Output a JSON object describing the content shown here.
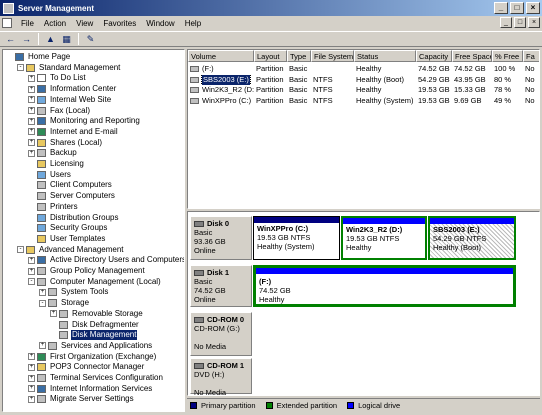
{
  "window": {
    "title": "Server Management",
    "controls": [
      "_",
      "□",
      "×"
    ]
  },
  "menu": {
    "items": [
      "File",
      "Action",
      "View",
      "Favorites",
      "Window",
      "Help"
    ],
    "controls": [
      "_",
      "□",
      "×"
    ]
  },
  "toolbar": {
    "buttons": [
      "back-icon",
      "forward-icon",
      "up-icon",
      "console-tree-icon",
      "properties-icon"
    ],
    "glyphs": [
      "←",
      "→",
      "▲",
      "▦",
      "✎"
    ]
  },
  "tree": [
    {
      "label": "Home Page",
      "level": 0,
      "exp": "",
      "icon": "home-icon",
      "color": "#3a6ea5"
    },
    {
      "label": "Standard Management",
      "level": 1,
      "exp": "-",
      "icon": "folder-icon",
      "color": "#e8c860"
    },
    {
      "label": "To Do List",
      "level": 2,
      "exp": "+",
      "icon": "list-icon",
      "color": "#ffffff"
    },
    {
      "label": "Information Center",
      "level": 2,
      "exp": "+",
      "icon": "info-icon",
      "color": "#3a6ea5"
    },
    {
      "label": "Internal Web Site",
      "level": 2,
      "exp": "+",
      "icon": "web-icon",
      "color": "#6fa8dc"
    },
    {
      "label": "Fax (Local)",
      "level": 2,
      "exp": "+",
      "icon": "fax-icon",
      "color": "#c0c0c0"
    },
    {
      "label": "Monitoring and Reporting",
      "level": 2,
      "exp": "+",
      "icon": "monitor-icon",
      "color": "#3a6ea5"
    },
    {
      "label": "Internet and E-mail",
      "level": 2,
      "exp": "+",
      "icon": "globe-icon",
      "color": "#2e8b57"
    },
    {
      "label": "Shares (Local)",
      "level": 2,
      "exp": "+",
      "icon": "share-icon",
      "color": "#e8c860"
    },
    {
      "label": "Backup",
      "level": 2,
      "exp": "+",
      "icon": "backup-icon",
      "color": "#c0c0c0"
    },
    {
      "label": "Licensing",
      "level": 2,
      "exp": "",
      "icon": "license-icon",
      "color": "#e8c860"
    },
    {
      "label": "Users",
      "level": 2,
      "exp": "",
      "icon": "users-icon",
      "color": "#6fa8dc"
    },
    {
      "label": "Client Computers",
      "level": 2,
      "exp": "",
      "icon": "computer-icon",
      "color": "#c0c0c0"
    },
    {
      "label": "Server Computers",
      "level": 2,
      "exp": "",
      "icon": "server-icon",
      "color": "#c0c0c0"
    },
    {
      "label": "Printers",
      "level": 2,
      "exp": "",
      "icon": "printer-icon",
      "color": "#c0c0c0"
    },
    {
      "label": "Distribution Groups",
      "level": 2,
      "exp": "",
      "icon": "group-icon",
      "color": "#6fa8dc"
    },
    {
      "label": "Security Groups",
      "level": 2,
      "exp": "",
      "icon": "group-icon",
      "color": "#6fa8dc"
    },
    {
      "label": "User Templates",
      "level": 2,
      "exp": "",
      "icon": "template-icon",
      "color": "#e8c860"
    },
    {
      "label": "Advanced Management",
      "level": 1,
      "exp": "-",
      "icon": "folder-icon",
      "color": "#e8c860"
    },
    {
      "label": "Active Directory Users and Computers",
      "level": 2,
      "exp": "+",
      "icon": "directory-icon",
      "color": "#3a6ea5"
    },
    {
      "label": "Group Policy Management",
      "level": 2,
      "exp": "+",
      "icon": "policy-icon",
      "color": "#c0c0c0"
    },
    {
      "label": "Computer Management (Local)",
      "level": 2,
      "exp": "-",
      "icon": "computer-icon",
      "color": "#c0c0c0"
    },
    {
      "label": "System Tools",
      "level": 3,
      "exp": "+",
      "icon": "tools-icon",
      "color": "#c0c0c0"
    },
    {
      "label": "Storage",
      "level": 3,
      "exp": "-",
      "icon": "storage-icon",
      "color": "#c0c0c0"
    },
    {
      "label": "Removable Storage",
      "level": 4,
      "exp": "+",
      "icon": "removable-icon",
      "color": "#c0c0c0"
    },
    {
      "label": "Disk Defragmenter",
      "level": 4,
      "exp": "",
      "icon": "defrag-icon",
      "color": "#c0c0c0"
    },
    {
      "label": "Disk Management",
      "level": 4,
      "exp": "",
      "icon": "disk-icon",
      "color": "#c0c0c0",
      "selected": true
    },
    {
      "label": "Services and Applications",
      "level": 3,
      "exp": "+",
      "icon": "services-icon",
      "color": "#c0c0c0"
    },
    {
      "label": "First Organization (Exchange)",
      "level": 2,
      "exp": "+",
      "icon": "exchange-icon",
      "color": "#2e8b57"
    },
    {
      "label": "POP3 Connector Manager",
      "level": 2,
      "exp": "+",
      "icon": "mail-icon",
      "color": "#e8c860"
    },
    {
      "label": "Terminal Services Configuration",
      "level": 2,
      "exp": "+",
      "icon": "terminal-icon",
      "color": "#c0c0c0"
    },
    {
      "label": "Internet Information Services",
      "level": 2,
      "exp": "+",
      "icon": "iis-icon",
      "color": "#3a6ea5"
    },
    {
      "label": "Migrate Server Settings",
      "level": 2,
      "exp": "+",
      "icon": "migrate-icon",
      "color": "#c0c0c0"
    }
  ],
  "volume_list": {
    "columns": [
      "Volume",
      "Layout",
      "Type",
      "File System",
      "Status",
      "Capacity",
      "Free Space",
      "% Free",
      "Fa"
    ],
    "rows": [
      [
        "(F:)",
        "Partition",
        "Basic",
        "",
        "Healthy",
        "74.52 GB",
        "74.52 GB",
        "100 %",
        "No"
      ],
      [
        "SBS2003 (E:)",
        "Partition",
        "Basic",
        "NTFS",
        "Healthy (Boot)",
        "54.29 GB",
        "43.95 GB",
        "80 %",
        "No"
      ],
      [
        "Win2K3_R2 (D:)",
        "Partition",
        "Basic",
        "NTFS",
        "Healthy",
        "19.53 GB",
        "15.33 GB",
        "78 %",
        "No"
      ],
      [
        "WinXPPro (C:)",
        "Partition",
        "Basic",
        "NTFS",
        "Healthy (System)",
        "19.53 GB",
        "9.69 GB",
        "49 %",
        "No"
      ]
    ],
    "selected_row": 1
  },
  "disks": [
    {
      "name": "Disk 0",
      "type": "Basic",
      "size": "93.36 GB",
      "state": "Online",
      "partitions": [
        {
          "name": "WinXPPro  (C:)",
          "detail": "19.53 GB NTFS",
          "status": "Healthy (System)",
          "hatch": false
        },
        {
          "name": "Win2K3_R2  (D:)",
          "detail": "19.53 GB NTFS",
          "status": "Healthy",
          "hatch": false
        },
        {
          "name": "SBS2003  (E:)",
          "detail": "54.29 GB NTFS",
          "status": "Healthy (Boot)",
          "hatch": true
        }
      ]
    },
    {
      "name": "Disk 1",
      "type": "Basic",
      "size": "74.52 GB",
      "state": "Online",
      "partitions": [
        {
          "name": "(F:)",
          "detail": "74.52 GB",
          "status": "Healthy",
          "hatch": false
        }
      ]
    },
    {
      "name": "CD-ROM 0",
      "type": "CD-ROM (G:)",
      "size": "",
      "state": "No Media",
      "partitions": []
    },
    {
      "name": "CD-ROM 1",
      "type": "DVD (H:)",
      "size": "",
      "state": "No Media",
      "partitions": []
    }
  ],
  "legend": [
    {
      "label": "Primary partition",
      "color": "#000080"
    },
    {
      "label": "Extended partition",
      "color": "#008000"
    },
    {
      "label": "Logical drive",
      "color": "#0000ff"
    }
  ],
  "colors": {
    "primary": "#000080",
    "extended": "#008000",
    "logical": "#0000ff",
    "selection": "#0a246a"
  }
}
